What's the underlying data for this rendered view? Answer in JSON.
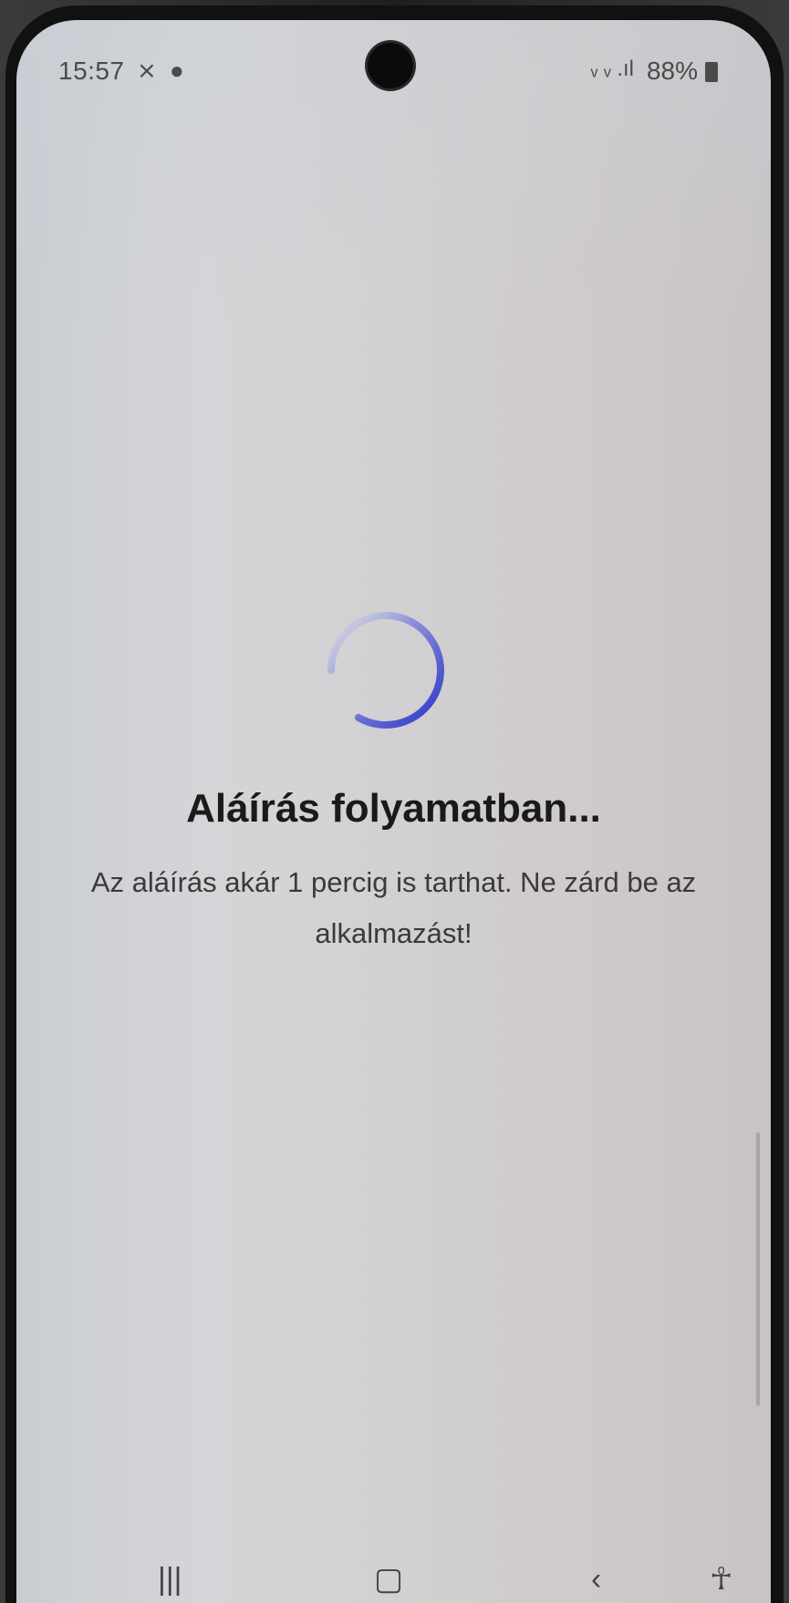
{
  "statusbar": {
    "time": "15:57",
    "left_icons": [
      "x-icon",
      "app-icon"
    ],
    "signal_text": "ᵥ ᵥ .ıl",
    "battery": "88%"
  },
  "loading": {
    "spinner": "loading-spinner",
    "title": "Aláírás folyamatban...",
    "message": "Az aláírás akár 1 percig is tarthat. Ne zárd be az alkalmazást!"
  },
  "navbar": {
    "recents": "|||",
    "home": "▢",
    "back": "‹",
    "accessibility": "accessibility-icon"
  },
  "colors": {
    "spinner_dark": "#2b35c9",
    "spinner_light": "#c8c8da",
    "title": "#1a1a1a"
  }
}
